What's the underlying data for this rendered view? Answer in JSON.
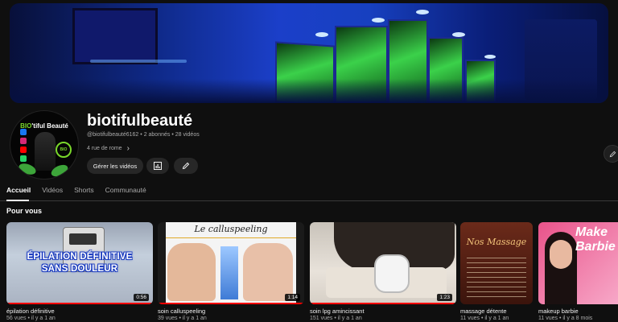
{
  "channel": {
    "name": "biotifulbeauté",
    "handle": "@biotifulbeauté6162",
    "subscribers": "2 abonnés",
    "videos": "28 vidéos",
    "separator": "•",
    "description": "4 rue de rome",
    "more_icon": "chevron-right-icon"
  },
  "avatar": {
    "brand_prefix": "BIO",
    "brand_suffix": "'tiful Beauté",
    "badge": "BIO"
  },
  "actions": {
    "manage_label": "Gérer les vidéos",
    "analytics_icon": "analytics-icon",
    "edit_icon": "pencil-icon"
  },
  "tabs": [
    {
      "label": "Accueil",
      "active": true
    },
    {
      "label": "Vidéos",
      "active": false
    },
    {
      "label": "Shorts",
      "active": false
    },
    {
      "label": "Communauté",
      "active": false
    }
  ],
  "section_title": "Pour vous",
  "videos": [
    {
      "title": "épilation définitive",
      "meta": "56 vues • il y a 1 an",
      "duration": "0:56",
      "thumb_text": "ÉPILATION DÉFINITIVE\nSANS DOULEUR",
      "watched": 1.0
    },
    {
      "title": "soin calluspeeling",
      "meta": "39 vues • il y a 1 an",
      "duration": "1:14",
      "thumb_text": "Le calluspeeling",
      "watched": 1.0
    },
    {
      "title": "soin lpg amincissant",
      "meta": "151 vues • il y a 1 an",
      "duration": "1:23",
      "thumb_text": "",
      "watched": 1.0
    },
    {
      "title": "massage détente",
      "meta": "11 vues • il y a 1 an",
      "duration": "",
      "thumb_text": "Nos Massage",
      "watched": 0
    },
    {
      "title": "makeup barbie",
      "meta": "11 vues • il y a 8 mois",
      "duration": "",
      "thumb_text": "Make Barbie",
      "watched": 0
    }
  ],
  "colors": {
    "accent": "#ff0000",
    "brand_green": "#7ad82b",
    "banner_blue": "#1b3fc9"
  }
}
